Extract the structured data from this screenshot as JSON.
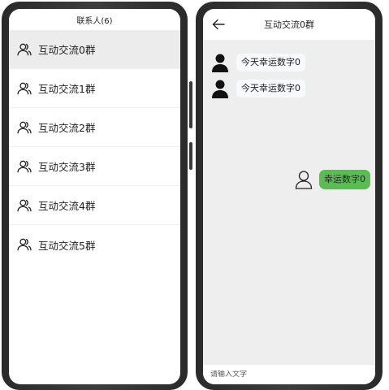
{
  "contacts_screen": {
    "header_title": "联系人(6)",
    "contacts": [
      {
        "name": "互动交流0群",
        "selected": true
      },
      {
        "name": "互动交流1群",
        "selected": false
      },
      {
        "name": "互动交流2群",
        "selected": false
      },
      {
        "name": "互动交流3群",
        "selected": false
      },
      {
        "name": "互动交流4群",
        "selected": false
      },
      {
        "name": "互动交流5群",
        "selected": false
      }
    ]
  },
  "chat_screen": {
    "title": "互动交流0群",
    "messages": [
      {
        "side": "incoming",
        "text": "今天幸运数字0"
      },
      {
        "side": "incoming",
        "text": "今天幸运数字0"
      },
      {
        "side": "outgoing",
        "text": "幸运数字0"
      }
    ],
    "input": {
      "value": "",
      "placeholder": "请输入文字"
    }
  },
  "colors": {
    "selected_row": "#ececec",
    "chat_background": "#eeeeee",
    "outgoing_bubble": "#5cbc54",
    "incoming_bubble": "#f7f9fd",
    "phone_frame": "#2a2a2a"
  },
  "icons": {
    "contact": "group-person-outline-icon",
    "back": "arrow-left-icon",
    "incoming_avatar": "person-filled-icon",
    "outgoing_avatar": "person-outline-icon"
  }
}
